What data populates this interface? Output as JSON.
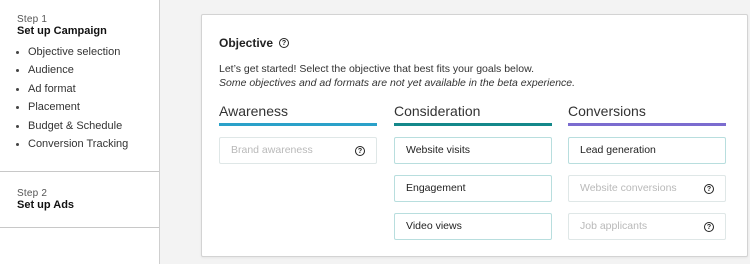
{
  "sidebar": {
    "step1": {
      "label": "Step 1",
      "title": "Set up Campaign",
      "items": [
        "Objective selection",
        "Audience",
        "Ad format",
        "Placement",
        "Budget & Schedule",
        "Conversion Tracking"
      ]
    },
    "step2": {
      "label": "Step 2",
      "title": "Set up Ads"
    }
  },
  "objective": {
    "title": "Objective",
    "help_icon": "?",
    "intro": "Let’s get started! Select the objective that best fits your goals below.",
    "note": "Some objectives and ad formats are not yet available in the beta experience.",
    "columns": [
      {
        "heading": "Awareness",
        "color": "#2aa1c9",
        "options": [
          {
            "label": "Brand awareness",
            "disabled": true,
            "help": "?"
          }
        ]
      },
      {
        "heading": "Consideration",
        "color": "#14888a",
        "options": [
          {
            "label": "Website visits"
          },
          {
            "label": "Engagement"
          },
          {
            "label": "Video views"
          }
        ]
      },
      {
        "heading": "Conversions",
        "color": "#7b6ccf",
        "options": [
          {
            "label": "Lead generation"
          },
          {
            "label": "Website conversions",
            "disabled": true,
            "help": "?"
          },
          {
            "label": "Job applicants",
            "disabled": true,
            "help": "?"
          }
        ]
      }
    ]
  }
}
